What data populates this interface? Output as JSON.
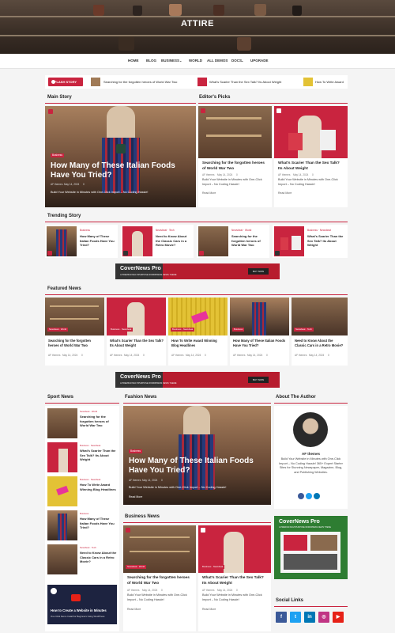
{
  "site": {
    "title": "ATTIRE"
  },
  "nav": {
    "items": [
      "HOME",
      "BLOG",
      "BUSINESS",
      "WORLD",
      "ALL DEMOS",
      "DOCS",
      "UPGRADE"
    ]
  },
  "flash": {
    "label": "FLASH STORY",
    "items": [
      "Searching for the forgotten heroes of World War Two",
      "What's Scarier Than the Sex Talk? Its About Weight",
      "How To Write Award"
    ]
  },
  "main_story": {
    "section_title": "Main Story",
    "category": "Business",
    "title": "How Many of These Italian Foods Have You Tried?",
    "author": "AF themes",
    "date": "May 14, 2024",
    "comments": "0",
    "excerpt": "Build Your Website in Minutes with One-Click Import – No Coding Hassle!"
  },
  "editors_picks": {
    "section_title": "Editor's Picks",
    "posts": [
      {
        "title": "Searching for the forgotten heroes of World War Two",
        "author": "AF themes",
        "date": "May 14, 2024",
        "comments": "0",
        "excerpt": "Build Your Website in Minutes with One-Click Import – No Coding Hassle!",
        "more": "Read More"
      },
      {
        "title": "What's Scarier Than the Sex Talk? Its About Weight",
        "author": "AF themes",
        "date": "May 14, 2024",
        "comments": "0",
        "excerpt": "Build Your Website in Minutes with One-Click Import – No Coding Hassle!",
        "more": "Read More"
      }
    ]
  },
  "trending": {
    "section_title": "Trending Story",
    "posts": [
      {
        "category": "Business",
        "title": "How Many of These Italian Foods Have You Tried?"
      },
      {
        "category": "Newsbeat · Tech",
        "title": "Need to Know About the Classic Cars in a Retro Movie?"
      },
      {
        "category": "Newsbeat · World",
        "title": "Searching for the forgotten heroes of World War Two"
      },
      {
        "category": "Business · Newsbeat",
        "title": "What's Scarier Than the Sex Talk? Its About Weight"
      }
    ]
  },
  "promo": {
    "name": "CoverNews Pro",
    "tagline": "A PREMIUM MULTIPURPOSE WORDPRESS NEWS THEME",
    "cta": "BUY NOW"
  },
  "featured": {
    "section_title": "Featured News",
    "posts": [
      {
        "cats": "Newsbeat · World",
        "title": "Searching for the forgotten heroes of World War Two",
        "author": "AF themes",
        "date": "May 14, 2024",
        "comments": "0"
      },
      {
        "cats": "Business · Newsbeat",
        "title": "What's Scarier Than the Sex Talk? Its About Weight",
        "author": "AF themes",
        "date": "May 14, 2024",
        "comments": "0"
      },
      {
        "cats": "Business · Newsbeat",
        "title": "How To Write Award Winning Blog Headlines",
        "author": "AF themes",
        "date": "May 14, 2024",
        "comments": "0"
      },
      {
        "cats": "Business",
        "title": "How Many of These Italian Foods Have You Tried?",
        "author": "AF themes",
        "date": "May 14, 2024",
        "comments": "0"
      },
      {
        "cats": "Newsbeat · Tech",
        "title": "Need to Know About the Classic Cars in a Retro Movie?",
        "author": "AF themes",
        "date": "May 14, 2024",
        "comments": "0"
      }
    ]
  },
  "sport": {
    "section_title": "Sport News",
    "posts": [
      {
        "category": "Newsbeat · World",
        "title": "Searching for the forgotten heroes of World War Two"
      },
      {
        "category": "Business · Newsbeat",
        "title": "What's Scarier Than the Sex Talk? Its About Weight"
      },
      {
        "category": "Business · Newsbeat",
        "title": "How To Write Award Winning Blog Headlines"
      },
      {
        "category": "Business",
        "title": "How Many of These Italian Foods Have You Tried?"
      },
      {
        "category": "Newsbeat · Tech",
        "title": "Need to Know About the Classic Cars in a Retro Movie?"
      },
      {
        "title": "How to Create a Website in Minutes",
        "subtitle": "One Click Demo Install for Beginners Using WordPress"
      }
    ]
  },
  "fashion": {
    "section_title": "Fashion News",
    "category": "Business",
    "title": "How Many of These Italian Foods Have You Tried?",
    "author": "AF themes",
    "date": "May 14, 2024",
    "comments": "0",
    "excerpt": "Build Your Website in Minutes with One-Click Import – No Coding Hassle!",
    "more": "Read More"
  },
  "business": {
    "section_title": "Business News",
    "posts": [
      {
        "cats": "Newsbeat · World",
        "title": "Searching for the forgotten heroes of World War Two",
        "author": "AF themes",
        "date": "May 14, 2024",
        "comments": "0",
        "excerpt": "Build Your Website in Minutes with One-Click Import – No Coding Hassle!",
        "more": "Read More"
      },
      {
        "cats": "Business · Newsbeat",
        "title": "What's Scarier Than the Sex Talk? Its About Weight",
        "author": "AF themes",
        "date": "May 14, 2024",
        "comments": "0",
        "excerpt": "Build Your Website in Minutes with One-Click Import – No Coding Hassle!",
        "more": "Read More"
      }
    ]
  },
  "author": {
    "section_title": "About The Author",
    "name": "AF themes",
    "bio": "Build Your Website in Minutes with One-Click Import – No Coding Hassle! 365+ Expert Starter Sites for Stunning Newspaper, Magazine, Blog, and Publishing Websites."
  },
  "social_links": {
    "section_title": "Social Links",
    "networks": [
      "facebook-icon",
      "twitter-icon",
      "linkedin-icon",
      "instagram-icon",
      "youtube-icon"
    ]
  },
  "colors": {
    "accent": "#c9243f",
    "facebook": "#3b5998",
    "twitter": "#1da1f2",
    "linkedin": "#0077b5",
    "instagram": "#c13584",
    "youtube": "#e62117"
  }
}
